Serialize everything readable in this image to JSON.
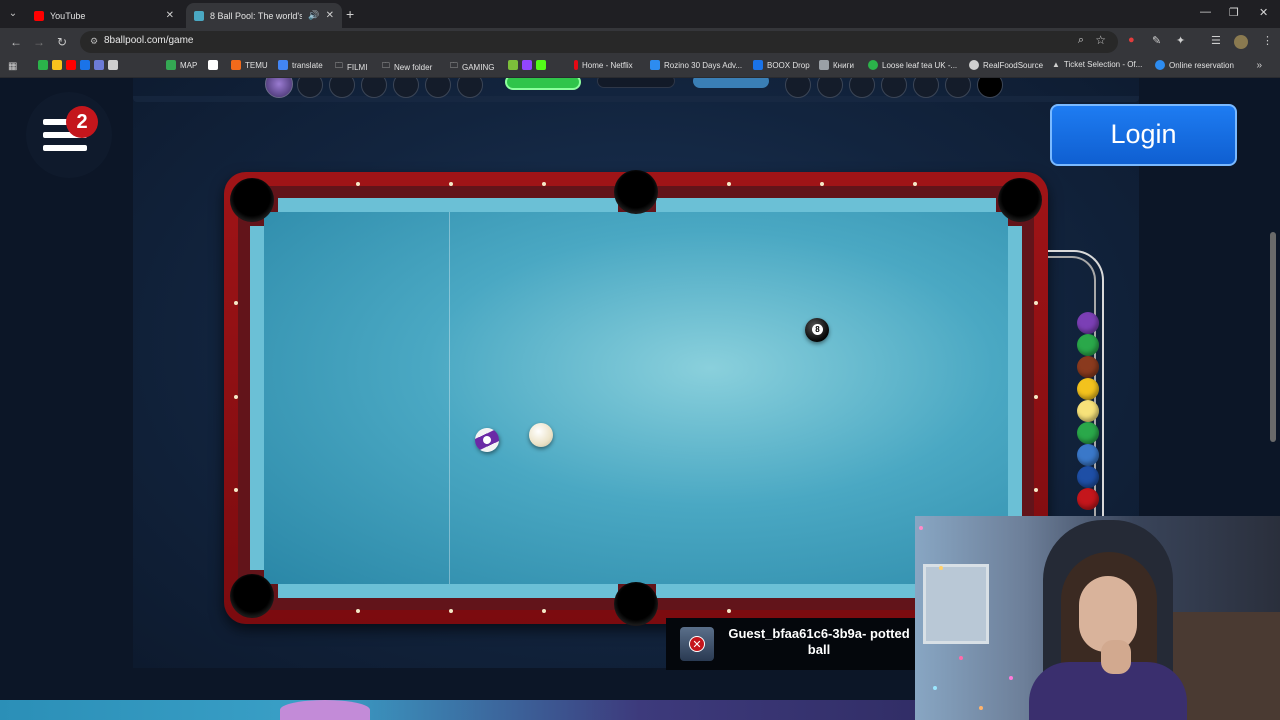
{
  "browser": {
    "tabs": [
      {
        "title": "YouTube",
        "favicon_color": "#ff0000"
      },
      {
        "title": "8 Ball Pool: The world's #1",
        "favicon_color": "#4aa8c3"
      }
    ],
    "url": "8ballpool.com/game",
    "bookmarks": [
      {
        "label": "MAP",
        "color": "#34a853"
      },
      {
        "label": "TEMU",
        "color": "#f26a1b"
      },
      {
        "label": "translate",
        "color": "#4285f4"
      },
      {
        "label": "FILMI",
        "color": "#9aa0a6"
      },
      {
        "label": "New folder",
        "color": "#9aa0a6"
      },
      {
        "label": "GAMING",
        "color": "#9aa0a6"
      },
      {
        "label": "Home - Netflix",
        "color": "#e50914"
      },
      {
        "label": "Rozino 30 Days Adv...",
        "color": "#2d8cf0"
      },
      {
        "label": "BOOX Drop",
        "color": "#1a73e8"
      },
      {
        "label": "Книги",
        "color": "#9aa0a6"
      },
      {
        "label": "Loose leaf tea UK -...",
        "color": "#2bb34a"
      },
      {
        "label": "RealFoodSource",
        "color": "#cfcfcf"
      },
      {
        "label": "Ticket Selection - Of...",
        "color": "#cfcfcf"
      },
      {
        "label": "Online reservation",
        "color": "#2d8cf0"
      }
    ]
  },
  "game": {
    "menu_badge": "2",
    "login_label": "Login",
    "toast_text": "Guest_bfaa61c6-3b9a- potted ball",
    "eight_ball_number": "8",
    "rack_colors": [
      "#7b3fb5",
      "#2aa84a",
      "#8a3a1e",
      "#f3c21d",
      "#f7e27a",
      "#2aa84a",
      "#3a78c9",
      "#1e4fa6",
      "#c4161c"
    ]
  }
}
